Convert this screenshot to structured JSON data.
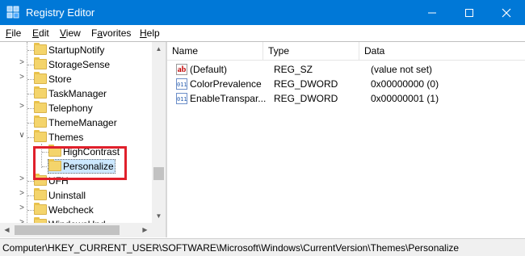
{
  "window": {
    "title": "Registry Editor"
  },
  "menu": [
    {
      "mnemonic": "F",
      "rest": "ile"
    },
    {
      "mnemonic": "E",
      "rest": "dit"
    },
    {
      "mnemonic": "V",
      "rest": "iew"
    },
    {
      "prefix": "F",
      "mnemonic": "a",
      "rest": "vorites"
    },
    {
      "mnemonic": "H",
      "rest": "elp"
    }
  ],
  "tree": {
    "items": [
      {
        "label": "StartupNotify"
      },
      {
        "label": "StorageSense"
      },
      {
        "label": "Store"
      },
      {
        "label": "TaskManager"
      },
      {
        "label": "Telephony"
      },
      {
        "label": "ThemeManager"
      },
      {
        "label": "Themes",
        "expanded": true
      },
      {
        "label": "HighContrast"
      },
      {
        "label": "Personalize",
        "selected": true
      },
      {
        "label": "UFH"
      },
      {
        "label": "Uninstall"
      },
      {
        "label": "Webcheck"
      },
      {
        "label": "WindowsUpd"
      }
    ]
  },
  "list": {
    "columns": [
      "Name",
      "Type",
      "Data"
    ],
    "rows": [
      {
        "icon": "string-value-icon",
        "glyph": "ab",
        "name": "(Default)",
        "type": "REG_SZ",
        "data": "(value not set)"
      },
      {
        "icon": "dword-value-icon",
        "glyph": "011",
        "name": "ColorPrevalence",
        "type": "REG_DWORD",
        "data": "0x00000000 (0)"
      },
      {
        "icon": "dword-value-icon",
        "glyph": "011",
        "name": "EnableTranspar...",
        "type": "REG_DWORD",
        "data": "0x00000001 (1)"
      }
    ]
  },
  "status": {
    "path": "Computer\\HKEY_CURRENT_USER\\SOFTWARE\\Microsoft\\Windows\\CurrentVersion\\Themes\\Personalize"
  },
  "colors": {
    "titlebar": "#0078d7",
    "highlight": "#e0202b",
    "selection": "#cce8ff"
  }
}
